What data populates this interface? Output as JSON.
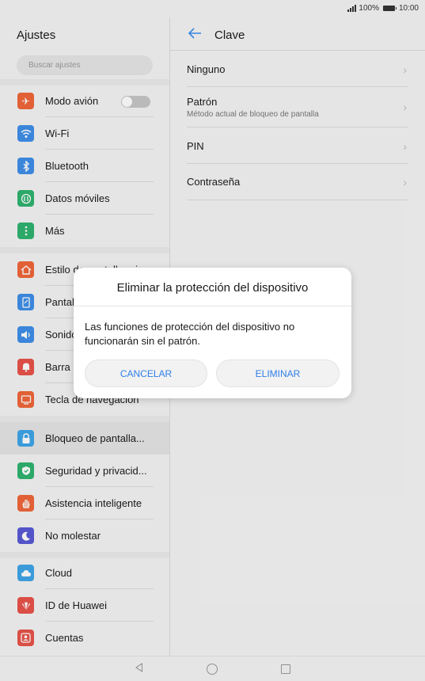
{
  "status": {
    "signal_icon": "signal-icon",
    "battery_pct": "100%",
    "time": "10:00"
  },
  "left": {
    "title": "Ajustes",
    "search_placeholder": "Buscar ajustes",
    "items": [
      {
        "label": "Modo avión",
        "icon": "airplane-icon",
        "color": "#f0673a"
      },
      {
        "label": "Wi-Fi",
        "icon": "wifi-icon",
        "color": "#3f8fe8"
      },
      {
        "label": "Bluetooth",
        "icon": "bluetooth-icon",
        "color": "#3f8fe8"
      },
      {
        "label": "Datos móviles",
        "icon": "mobile-data-icon",
        "color": "#2fb36f"
      },
      {
        "label": "Más",
        "icon": "more-icon",
        "color": "#2fb36f"
      },
      {
        "label": "Estilo de pantalla pri...",
        "icon": "home-style-icon",
        "color": "#f0673a"
      },
      {
        "label": "Pantalla",
        "icon": "display-icon",
        "color": "#3f8fe8"
      },
      {
        "label": "Sonido",
        "icon": "sound-icon",
        "color": "#3f8fe8"
      },
      {
        "label": "Barra de notificaciones",
        "icon": "notification-icon",
        "color": "#e8534a"
      },
      {
        "label": "Tecla de navegación",
        "icon": "navigation-key-icon",
        "color": "#f0673a"
      },
      {
        "label": "Bloqueo de pantalla...",
        "icon": "lock-icon",
        "color": "#3fa5e8"
      },
      {
        "label": "Seguridad y privacid...",
        "icon": "shield-icon",
        "color": "#2fb36f"
      },
      {
        "label": "Asistencia inteligente",
        "icon": "hand-icon",
        "color": "#f0673a"
      },
      {
        "label": "No molestar",
        "icon": "moon-icon",
        "color": "#5a5ad6"
      },
      {
        "label": "Cloud",
        "icon": "cloud-icon",
        "color": "#3fa5e8"
      },
      {
        "label": "ID de Huawei",
        "icon": "huawei-icon",
        "color": "#e8534a"
      },
      {
        "label": "Cuentas",
        "icon": "account-icon",
        "color": "#e8534a"
      }
    ],
    "airplane_toggle_on": false
  },
  "right": {
    "title": "Clave",
    "options": [
      {
        "label": "Ninguno",
        "sub": ""
      },
      {
        "label": "Patrón",
        "sub": "Método actual de bloqueo de pantalla"
      },
      {
        "label": "PIN",
        "sub": ""
      },
      {
        "label": "Contraseña",
        "sub": ""
      }
    ]
  },
  "dialog": {
    "title": "Eliminar la protección del dispositivo",
    "message": "Las funciones de protección del dispositivo no funcionarán sin el patrón.",
    "cancel_label": "CANCELAR",
    "remove_label": "ELIMINAR",
    "accent": "#2f7ee8"
  }
}
